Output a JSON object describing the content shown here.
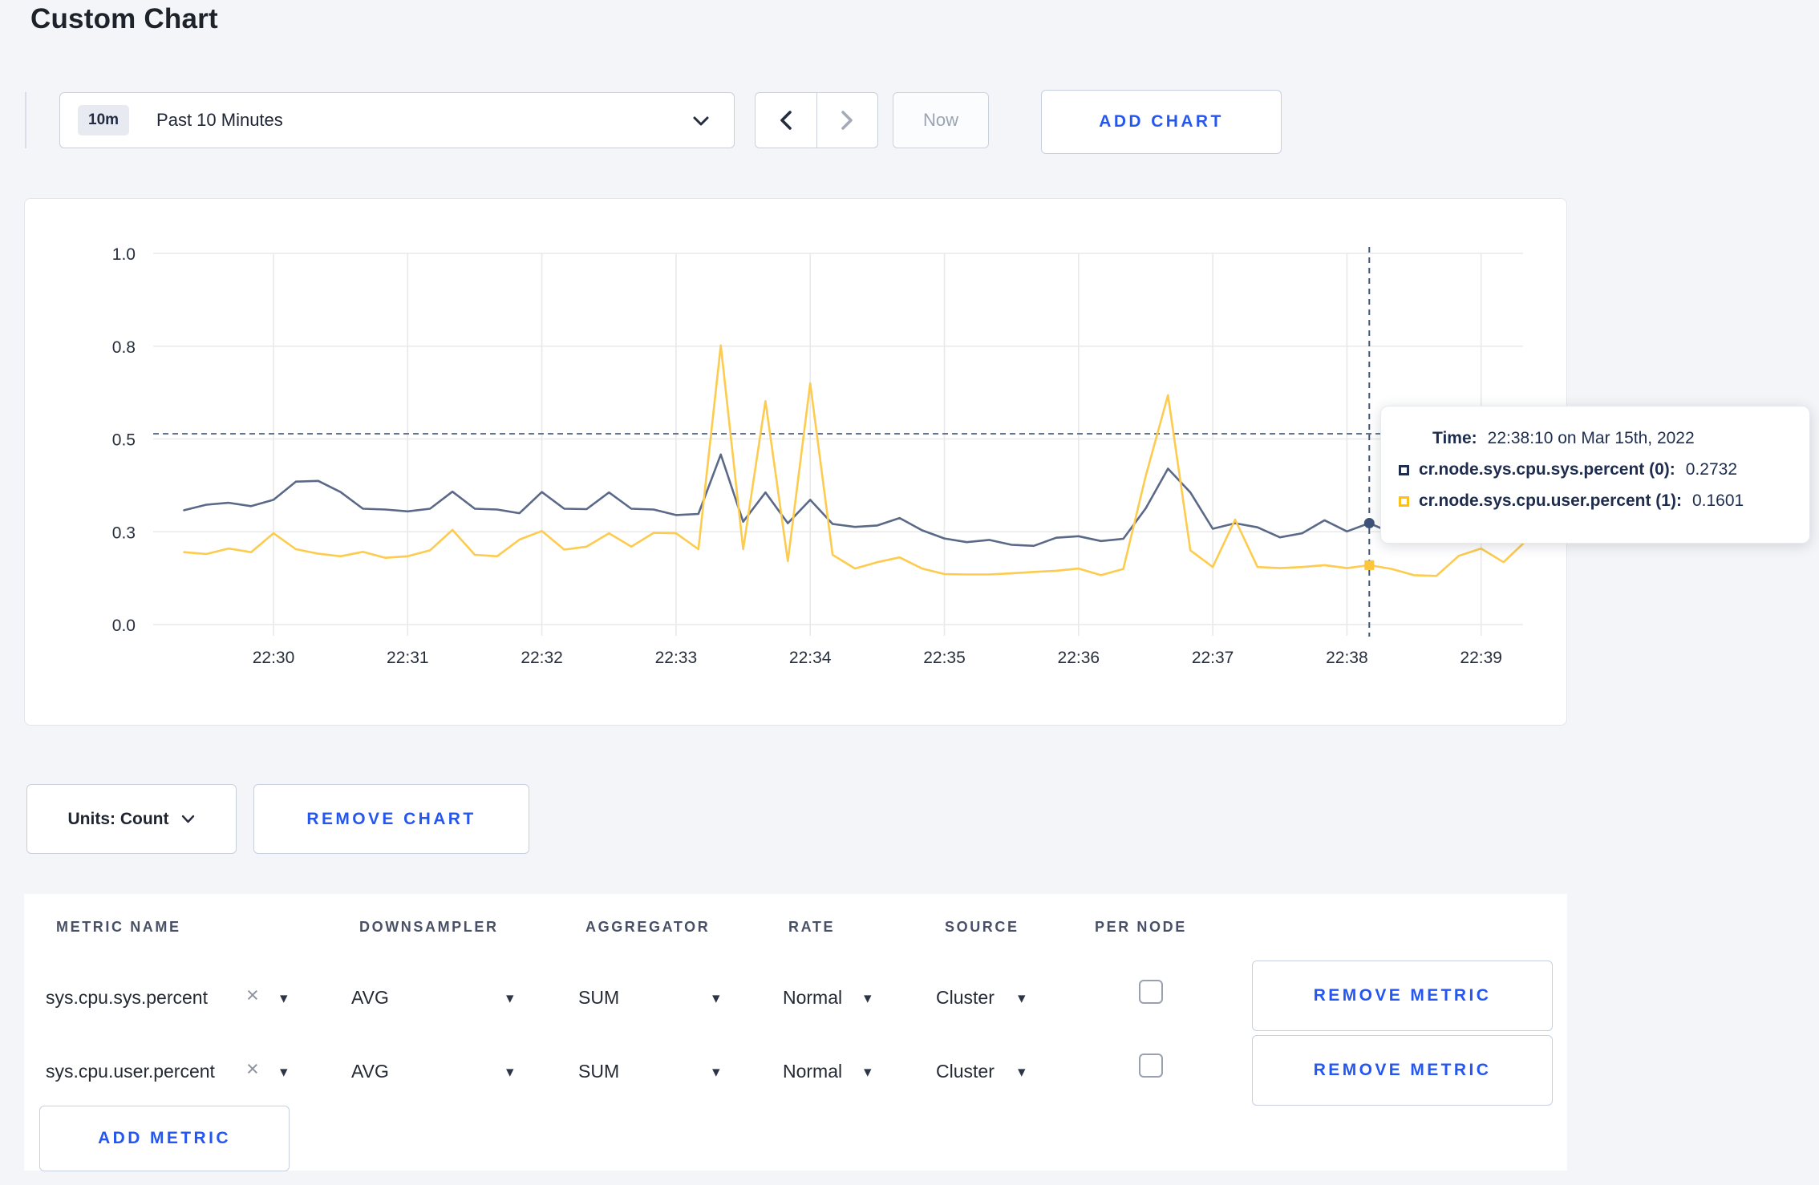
{
  "page": {
    "title": "Custom Chart"
  },
  "toolbar": {
    "range_badge": "10m",
    "range_label": "Past 10 Minutes",
    "now_label": "Now",
    "add_chart_label": "ADD CHART"
  },
  "icons": {
    "caret_down": "▾",
    "close_x": "×"
  },
  "controls": {
    "units_label": "Units: Count",
    "remove_chart_label": "REMOVE CHART"
  },
  "tooltip": {
    "time_label": "Time:",
    "time_value": "22:38:10 on Mar 15th, 2022",
    "series": [
      {
        "label": "cr.node.sys.cpu.sys.percent (0):",
        "value": "0.2732",
        "swatch_color": "#1f2d4d"
      },
      {
        "label": "cr.node.sys.cpu.user.percent (1):",
        "value": "0.1601",
        "swatch_color": "#fdc018"
      }
    ]
  },
  "metrics_table": {
    "columns": [
      "METRIC NAME",
      "DOWNSAMPLER",
      "AGGREGATOR",
      "RATE",
      "SOURCE",
      "PER NODE"
    ],
    "rows": [
      {
        "metric": "sys.cpu.sys.percent",
        "downsampler": "AVG",
        "aggregator": "SUM",
        "rate": "Normal",
        "source": "Cluster",
        "per_node_checked": false
      },
      {
        "metric": "sys.cpu.user.percent",
        "downsampler": "AVG",
        "aggregator": "SUM",
        "rate": "Normal",
        "source": "Cluster",
        "per_node_checked": false
      }
    ],
    "remove_metric_label": "REMOVE METRIC",
    "add_metric_label": "ADD METRIC"
  },
  "chart_data": {
    "type": "line",
    "title": "",
    "xlabel": "",
    "ylabel": "",
    "ylim": [
      0,
      1
    ],
    "grid": true,
    "legend_position": "tooltip-only",
    "x_start_label": "22:29:20",
    "x_interval_seconds": 10,
    "x_offset_to_first_tick_seconds": 40,
    "x_tick_labels": [
      "22:30",
      "22:31",
      "22:32",
      "22:33",
      "22:34",
      "22:35",
      "22:36",
      "22:37",
      "22:38",
      "22:39"
    ],
    "y_ticks": [
      {
        "v": 0,
        "label": "0.0"
      },
      {
        "v": 0.25,
        "label": "0.3"
      },
      {
        "v": 0.5,
        "label": "0.5"
      },
      {
        "v": 0.75,
        "label": "0.8"
      },
      {
        "v": 1,
        "label": "1.0"
      }
    ],
    "series": [
      {
        "name": "cr.node.sys.cpu.sys.percent (0)",
        "color": "#5a6987",
        "values": [
          0.308,
          0.323,
          0.328,
          0.319,
          0.336,
          0.385,
          0.387,
          0.357,
          0.312,
          0.31,
          0.305,
          0.312,
          0.358,
          0.312,
          0.31,
          0.3,
          0.357,
          0.312,
          0.311,
          0.356,
          0.312,
          0.31,
          0.295,
          0.298,
          0.458,
          0.277,
          0.356,
          0.273,
          0.336,
          0.271,
          0.263,
          0.267,
          0.287,
          0.254,
          0.232,
          0.222,
          0.228,
          0.215,
          0.212,
          0.234,
          0.238,
          0.225,
          0.231,
          0.313,
          0.42,
          0.356,
          0.258,
          0.273,
          0.262,
          0.235,
          0.246,
          0.281,
          0.251,
          0.2732,
          0.247,
          0.258,
          0.266,
          0.258,
          0.266,
          0.272,
          0.26
        ]
      },
      {
        "name": "cr.node.sys.cpu.user.percent (1)",
        "color": "#fdcb4d",
        "values": [
          0.195,
          0.19,
          0.205,
          0.195,
          0.246,
          0.203,
          0.191,
          0.184,
          0.196,
          0.18,
          0.184,
          0.2,
          0.255,
          0.188,
          0.184,
          0.229,
          0.252,
          0.202,
          0.21,
          0.246,
          0.21,
          0.247,
          0.246,
          0.203,
          0.752,
          0.203,
          0.602,
          0.171,
          0.65,
          0.188,
          0.151,
          0.168,
          0.181,
          0.151,
          0.136,
          0.135,
          0.135,
          0.138,
          0.142,
          0.145,
          0.151,
          0.133,
          0.15,
          0.4,
          0.618,
          0.2,
          0.155,
          0.283,
          0.155,
          0.152,
          0.155,
          0.16,
          0.152,
          0.1601,
          0.15,
          0.133,
          0.131,
          0.185,
          0.205,
          0.168,
          0.225
        ]
      }
    ],
    "crosshair": {
      "index": 53,
      "time": "22:38:10",
      "values": [
        0.2732,
        0.1601
      ],
      "h_line_value": 0.514,
      "marker_colors": [
        "#3e5379",
        "#fdc53a"
      ]
    }
  }
}
